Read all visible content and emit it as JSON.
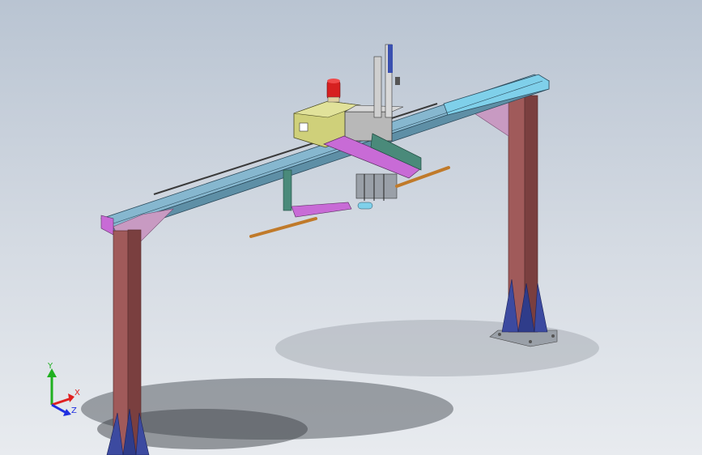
{
  "viewport": {
    "background_top": "#b9c4d2",
    "background_bottom": "#e8ebef"
  },
  "colors": {
    "column": "#a05a5a",
    "column_dark": "#7a3f3f",
    "base_gusset": "#3c4aa0",
    "bracket": "#c89ac2",
    "beam_top": "#86b7cf",
    "beam_cap": "#7fd0ea",
    "beam_side": "#5e8fa6",
    "carriage_box": "#cfd07a",
    "beacon": "#d62020",
    "slide_arm": "#c86bd6",
    "green_arm": "#4a8a7a",
    "rod": "#c07a2a",
    "gray_part": "#b8b8b8"
  },
  "triad": {
    "x_label": "X",
    "y_label": "Y",
    "z_label": "Z",
    "x_color": "#e02020",
    "y_color": "#20b020",
    "z_color": "#2030e0"
  }
}
